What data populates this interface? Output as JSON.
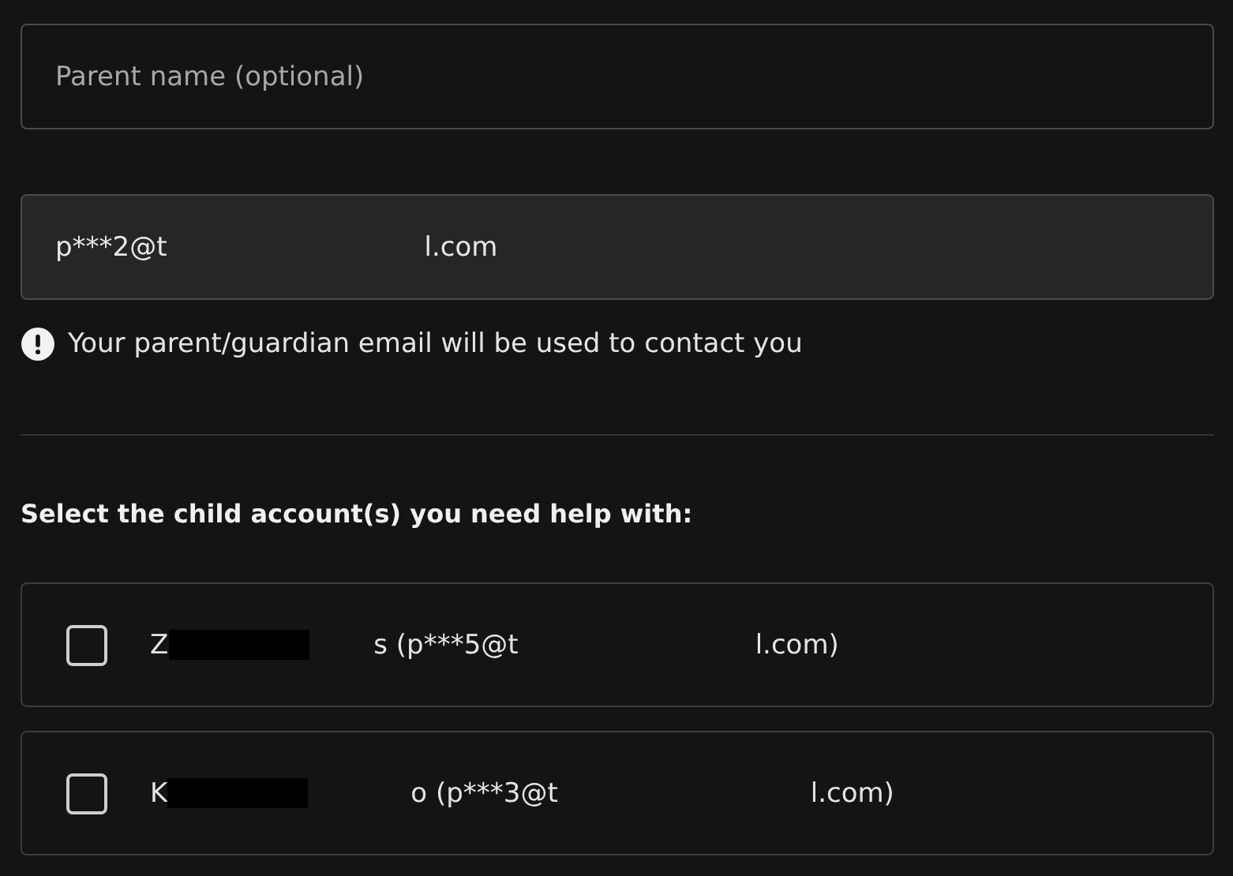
{
  "parent_name_field": {
    "placeholder": "Parent name (optional)"
  },
  "parent_email_field": {
    "value_start": "p***2@t",
    "value_end": "l.com"
  },
  "note": {
    "text": "Your parent/guardian email will be used to contact you"
  },
  "child_section": {
    "heading": "Select the child account(s) you need help with:",
    "accounts": [
      {
        "checked": false,
        "name_start": "Z",
        "name_end_and_email": "s (p***5@t",
        "email_end": "l.com)"
      },
      {
        "checked": false,
        "name_start": "K",
        "name_end_and_email": "o (p***3@t",
        "email_end": "l.com)"
      }
    ]
  }
}
